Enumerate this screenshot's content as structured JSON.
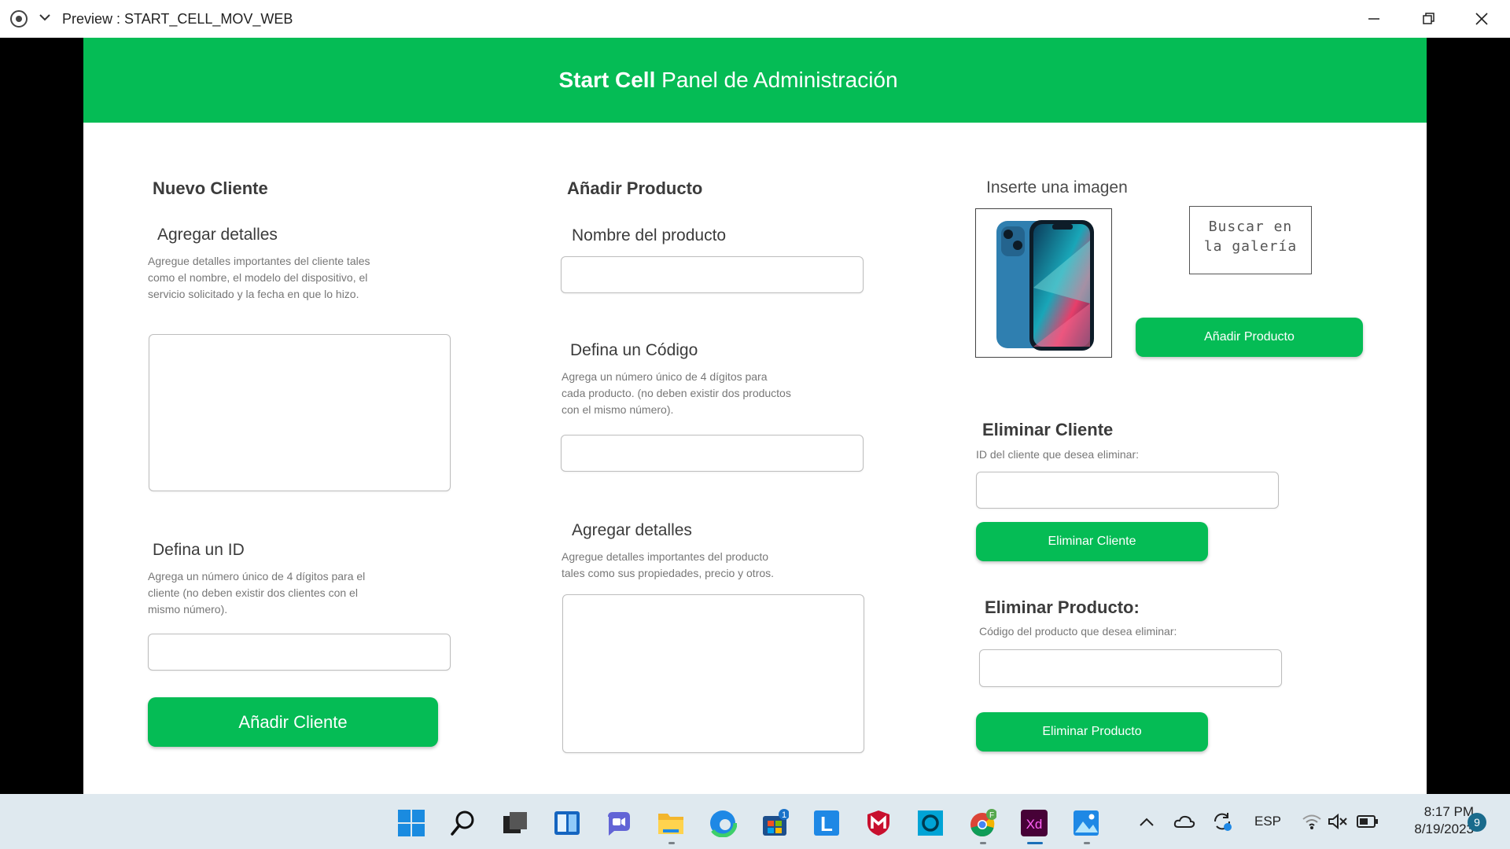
{
  "window": {
    "title": "Preview : START_CELL_MOV_WEB"
  },
  "header": {
    "brand": "Start Cell",
    "subtitle": "Panel de Administración"
  },
  "nuevo_cliente": {
    "title": "Nuevo Cliente",
    "details_label": "Agregar detalles",
    "details_desc": [
      "Agregue detalles importantes del cliente tales",
      "como el nombre, el modelo del dispositivo, el",
      "servicio solicitado y la fecha en que lo hizo."
    ],
    "details_value": "",
    "id_label": "Defina un ID",
    "id_desc": [
      "Agrega un número único de 4 dígitos para el",
      "cliente (no deben existir dos clientes con el",
      "mismo número)."
    ],
    "id_value": "",
    "button": "Añadir Cliente"
  },
  "producto": {
    "title": "Añadir Producto",
    "name_label": "Nombre del producto",
    "name_value": "",
    "code_label": "Defina un Código",
    "code_desc": [
      "Agrega un número único de 4 dígitos para",
      "cada producto. (no deben existir dos productos",
      "con el mismo número)."
    ],
    "code_value": "",
    "details_label": "Agregar detalles",
    "details_desc": [
      "Agregue detalles importantes del producto",
      "tales como sus propiedades, precio y otros."
    ],
    "details_value": ""
  },
  "imagen": {
    "label": "Inserte una imagen",
    "gallery_lines": [
      "Buscar en",
      "la galería"
    ],
    "button": "Añadir Producto"
  },
  "eliminar_cliente": {
    "title": "Eliminar Cliente",
    "desc": "ID del cliente que desea eliminar:",
    "value": "",
    "button": "Eliminar Cliente"
  },
  "eliminar_producto": {
    "title": "Eliminar Producto:",
    "desc": "Código del producto que desea eliminar:",
    "value": "",
    "button": "Eliminar Producto"
  },
  "taskbar": {
    "apps": [
      "start-icon",
      "search-icon",
      "task-view-icon",
      "widgets-icon",
      "teams-chat-icon",
      "file-explorer-icon",
      "edge-icon",
      "store-icon",
      "l-app-icon",
      "mcafee-icon",
      "cortana-icon",
      "chrome-icon",
      "adobe-xd-icon",
      "photos-icon"
    ],
    "store_badge": "1",
    "chrome_badge": "F",
    "xd_label": "Xd",
    "l_label": "L",
    "lang": "ESP",
    "time": "8:17 PM",
    "date": "8/19/2023",
    "notif_count": "9"
  },
  "colors": {
    "accent": "#05bc55",
    "header_text": "#ffffff",
    "taskbar": "#dfe9ef"
  }
}
